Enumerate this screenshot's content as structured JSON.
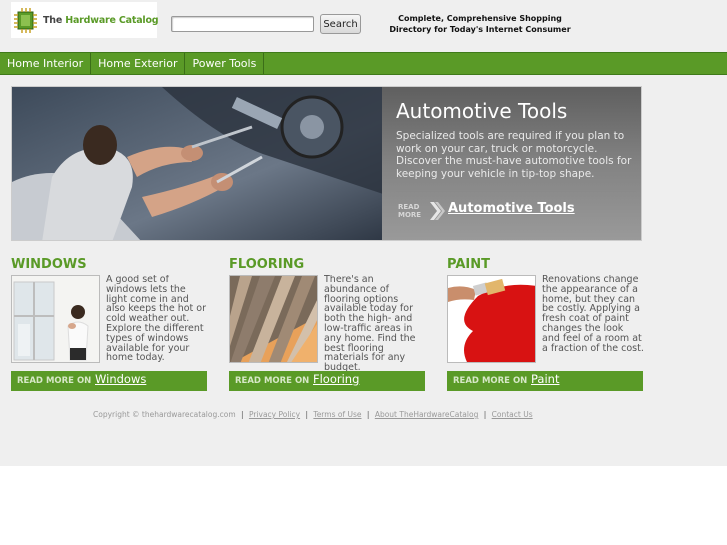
{
  "header": {
    "logo_text_prefix": "The ",
    "logo_text_main": "Hardware Catalog",
    "search": {
      "value": "",
      "placeholder": ""
    },
    "search_button_label": "Search",
    "tagline_line1": "Complete, Comprehensive Shopping",
    "tagline_line2": "Directory for Today's Internet Consumer"
  },
  "nav": {
    "items": [
      {
        "label": "Home Interior"
      },
      {
        "label": "Home Exterior"
      },
      {
        "label": "Power Tools"
      }
    ]
  },
  "hero": {
    "title": "Automotive Tools",
    "text": "Specialized tools are required if you plan to work on your car, truck or motorcycle. Discover the must-have automotive tools for keeping your vehicle in tip-top shape.",
    "read_more_line1": "READ",
    "read_more_line2": "MORE",
    "link_label": "Automotive Tools"
  },
  "features": [
    {
      "title": "WINDOWS",
      "text": "A good set of windows lets the light come in and also keeps the hot or cold weather out. Explore the different types of windows available for your home today.",
      "read_more": "READ MORE ON",
      "link": "Windows"
    },
    {
      "title": "FLOORING",
      "text": "There's an abundance of flooring options available today for both the high- and low-traffic areas in any home. Find the best flooring materials for any budget.",
      "read_more": "READ MORE ON",
      "link": "Flooring"
    },
    {
      "title": "PAINT",
      "text": "Renovations change the appearance of a home, but they can be costly. Applying a fresh coat of paint changes the look and feel of a room at a fraction of the cost.",
      "read_more": "READ MORE ON",
      "link": "Paint"
    }
  ],
  "footer": {
    "copyright": "Copyright © thehardwarecatalog.com",
    "separator": "|",
    "links": [
      "Privacy Policy",
      "Terms of Use",
      "About TheHardwareCatalog",
      "Contact Us"
    ]
  },
  "colors": {
    "brand_green": "#5a9a27",
    "page_background": "#efefef",
    "hero_panel": "#7a7a7a"
  }
}
